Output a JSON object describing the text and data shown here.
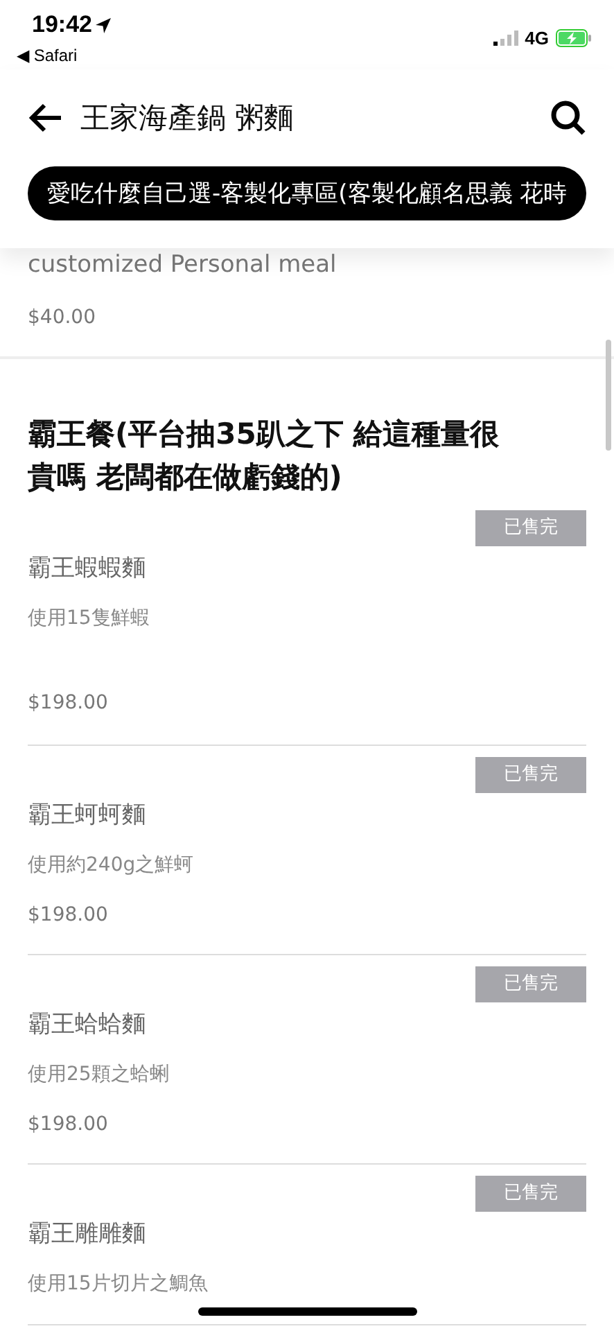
{
  "status_bar": {
    "time": "19:42",
    "back_app": "◀ Safari",
    "network": "4G"
  },
  "header": {
    "title": "王家海產鍋 粥麵"
  },
  "tabs": [
    {
      "label": "愛吃什麼自己選-客製化專區(客製化顧名思義 花時",
      "selected": true
    }
  ],
  "previous_item": {
    "description": "customized Personal meal",
    "price": "$40.00"
  },
  "section": {
    "title": "霸王餐(平台抽35趴之下 給這種量很貴嗎 老闆都在做虧錢的)",
    "items": [
      {
        "badge": "已售完",
        "name": "霸王蝦蝦麵",
        "description": "使用15隻鮮蝦",
        "price": "$198.00",
        "sold_out": true
      },
      {
        "badge": "已售完",
        "name": "霸王蚵蚵麵",
        "description": "使用約240g之鮮蚵",
        "price": "$198.00",
        "sold_out": true
      },
      {
        "badge": "已售完",
        "name": "霸王蛤蛤麵",
        "description": "使用25顆之蛤蜊",
        "price": "$198.00",
        "sold_out": true
      },
      {
        "badge": "已售完",
        "name": "霸王雕雕麵",
        "description": "使用15片切片之鯛魚",
        "sold_out": true
      }
    ]
  }
}
